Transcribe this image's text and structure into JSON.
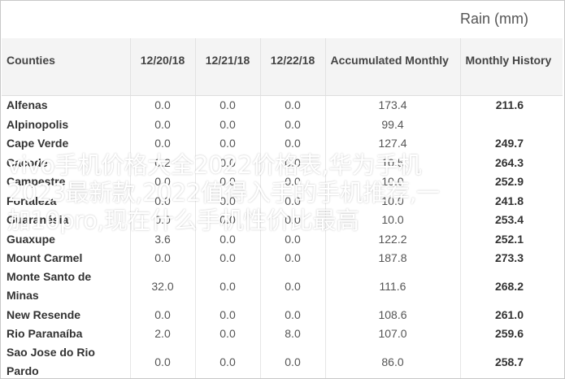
{
  "unit_label": "Rain (mm)",
  "table": {
    "headers": {
      "counties": "Counties",
      "d1": "12/20/18",
      "d2": "12/21/18",
      "d3": "12/22/18",
      "accumulated": "Accumulated Monthly",
      "history": "Monthly History"
    },
    "rows": [
      {
        "county": "Alfenas",
        "d1": "0.0",
        "d2": "0.0",
        "d3": "0.0",
        "acc": "173.4",
        "hist": "211.6"
      },
      {
        "county": "Alpinopolis",
        "d1": "0.0",
        "d2": "0.0",
        "d3": "0.0",
        "acc": "99.4",
        "hist": ""
      },
      {
        "county": "Cape Verde",
        "d1": "0.0",
        "d2": "0.0",
        "d3": "0.0",
        "acc": "127.4",
        "hist": "249.7"
      },
      {
        "county": "Cacode",
        "d1": "0.2",
        "d2": "0.0",
        "d3": "0.0",
        "acc": "10.5",
        "hist": "264.3"
      },
      {
        "county": "Campestre",
        "d1": "0.0",
        "d2": "0.0",
        "d3": "0.0",
        "acc": "10.0",
        "hist": "252.9"
      },
      {
        "county": "Fortaleza",
        "d1": "0.0",
        "d2": "0.0",
        "d3": "0.0",
        "acc": "10.0",
        "hist": "241.8"
      },
      {
        "county": "Guaranésia",
        "d1": "0.0",
        "d2": "0.0",
        "d3": "0.0",
        "acc": "10.0",
        "hist": "253.4"
      },
      {
        "county": "Guaxupe",
        "d1": "3.6",
        "d2": "0.0",
        "d3": "0.0",
        "acc": "122.2",
        "hist": "252.1"
      },
      {
        "county": "Mount Carmel",
        "d1": "0.0",
        "d2": "0.0",
        "d3": "0.0",
        "acc": "187.8",
        "hist": "273.3"
      },
      {
        "county": "Monte Santo de Minas",
        "d1": "32.0",
        "d2": "0.0",
        "d3": "0.0",
        "acc": "111.6",
        "hist": "268.2"
      },
      {
        "county": "New Resende",
        "d1": "0.0",
        "d2": "0.0",
        "d3": "0.0",
        "acc": "108.6",
        "hist": "261.0"
      },
      {
        "county": "Rio Paranaíba",
        "d1": "2.0",
        "d2": "0.0",
        "d3": "8.0",
        "acc": "107.0",
        "hist": "259.6"
      },
      {
        "county": "Sao Jose do Rio Pardo",
        "d1": "0.0",
        "d2": "0.0",
        "d3": "0.0",
        "acc": "86.0",
        "hist": "258.7"
      }
    ]
  },
  "overlay_text": "vivo手机价格大全2022价格表,华为手机2023最新款,2022值得入手的手机推荐,一加10pro,现在什么手机性价比最高",
  "colors": {
    "header_bg": "#f4f4f4",
    "overlay_text": "#ffffff"
  }
}
